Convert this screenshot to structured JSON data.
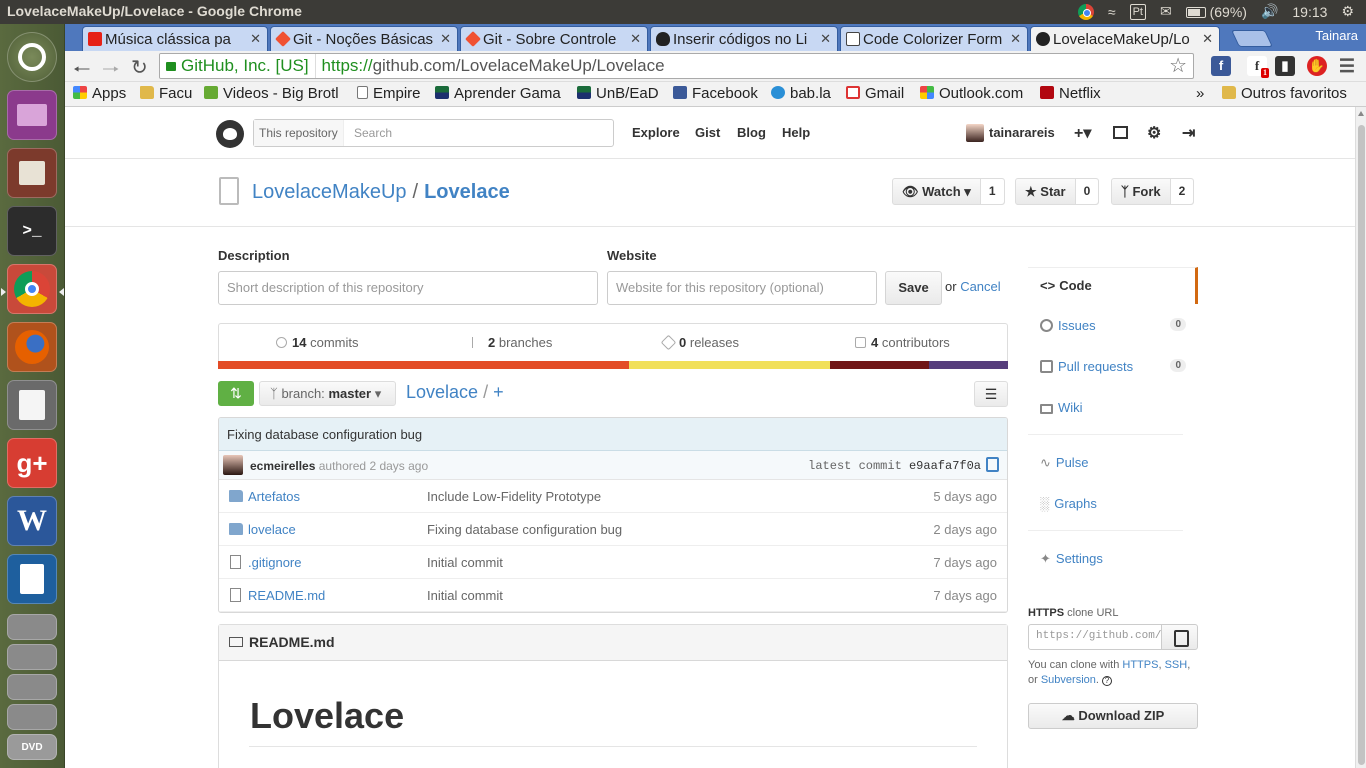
{
  "os": {
    "window_title": "LovelaceMakeUp/Lovelace - Google Chrome",
    "keyboard": "Pt",
    "battery": "(69%)",
    "clock": "19:13",
    "user": "Tainara",
    "launcher": [
      "ubuntu-dash-icon",
      "workspace-icon",
      "files-icon",
      "terminal-icon",
      "chrome-icon",
      "firefox-icon",
      "text-editor-icon",
      "google-plus-icon",
      "word-icon",
      "writer-icon",
      "drive-icon",
      "drive-icon",
      "drive-icon",
      "drive-icon",
      "dvd-icon"
    ]
  },
  "browser": {
    "tabs": [
      {
        "label": "Música clássica pa",
        "icon": "youtube-icon",
        "color": "#e62117"
      },
      {
        "label": "Git - Noções Básicas",
        "icon": "git-icon",
        "color": "#f05133"
      },
      {
        "label": "Git - Sobre Controle",
        "icon": "git-icon",
        "color": "#f05133"
      },
      {
        "label": "Inserir códigos no Li",
        "icon": "tux-icon",
        "color": "#222222"
      },
      {
        "label": "Code Colorizer Form",
        "icon": "page-icon",
        "color": "#ffffff"
      },
      {
        "label": "LovelaceMakeUp/Lo",
        "icon": "github-icon",
        "color": "#222222"
      }
    ],
    "ev_label": "GitHub, Inc. [US]",
    "url_scheme": "https://",
    "url_rest": "github.com/LovelaceMakeUp/Lovelace",
    "bookmarks": [
      {
        "label": "Apps",
        "icon": "apps-grid-icon"
      },
      {
        "label": "Facu",
        "icon": "folder-icon"
      },
      {
        "label": "Videos - Big Brotl",
        "icon": "video-icon"
      },
      {
        "label": "Empire",
        "icon": "page-icon"
      },
      {
        "label": "Aprender Gama",
        "icon": "flag-icon"
      },
      {
        "label": "UnB/EaD",
        "icon": "flag-icon"
      },
      {
        "label": "Facebook",
        "icon": "facebook-icon"
      },
      {
        "label": "bab.la",
        "icon": "bubble-icon"
      },
      {
        "label": "Gmail",
        "icon": "gmail-icon"
      },
      {
        "label": "Outlook.com",
        "icon": "windows-icon"
      },
      {
        "label": "Netflix",
        "icon": "netflix-icon"
      }
    ],
    "overflow": "»",
    "other_bookmarks": "Outros favoritos"
  },
  "github": {
    "search_scope": "This repository",
    "search_placeholder": "Search",
    "nav": [
      "Explore",
      "Gist",
      "Blog",
      "Help"
    ],
    "username": "tainarareis",
    "repo_owner": "LovelaceMakeUp",
    "repo_sep": "/",
    "repo_name": "Lovelace",
    "watch": {
      "label": "Watch",
      "count": "1"
    },
    "star": {
      "label": "Star",
      "count": "0"
    },
    "fork": {
      "label": "Fork",
      "count": "2"
    },
    "description_label": "Description",
    "description_placeholder": "Short description of this repository",
    "website_label": "Website",
    "website_placeholder": "Website for this repository (optional)",
    "save": "Save",
    "or": "or",
    "cancel": "Cancel",
    "summary": [
      {
        "num": "14",
        "label": "commits"
      },
      {
        "num": "2",
        "label": "branches"
      },
      {
        "num": "0",
        "label": "releases"
      },
      {
        "num": "4",
        "label": "contributors"
      }
    ],
    "languages": [
      {
        "share": 0.52,
        "color": "#e34c26"
      },
      {
        "share": 0.255,
        "color": "#f1e05a"
      },
      {
        "share": 0.125,
        "color": "#701516"
      },
      {
        "share": 0.1,
        "color": "#563d7c"
      }
    ],
    "branch_prefix": "branch:",
    "branch": "master",
    "breadcrumb_repo": "Lovelace",
    "breadcrumb_sep": "/",
    "breadcrumb_add": "+",
    "commit": {
      "title": "Fixing database configuration bug",
      "author": "ecmeirelles",
      "authored": "authored 2 days ago",
      "latest_label": "latest commit",
      "sha": "e9aafa7f0a"
    },
    "files": [
      {
        "type": "dir",
        "name": "Artefatos",
        "message": "Include Low-Fidelity Prototype",
        "age": "5 days ago"
      },
      {
        "type": "dir",
        "name": "lovelace",
        "message": "Fixing database configuration bug",
        "age": "2 days ago"
      },
      {
        "type": "file",
        "name": ".gitignore",
        "message": "Initial commit",
        "age": "7 days ago"
      },
      {
        "type": "file",
        "name": "README.md",
        "message": "Initial commit",
        "age": "7 days ago"
      }
    ],
    "readme_file": "README.md",
    "readme_heading": "Lovelace",
    "sidebar": [
      {
        "label": "Code",
        "icon": "code-icon",
        "selected": true
      },
      {
        "label": "Issues",
        "icon": "issue-icon",
        "badge": "0"
      },
      {
        "label": "Pull requests",
        "icon": "pull-request-icon",
        "badge": "0"
      },
      {
        "label": "Wiki",
        "icon": "book-icon"
      },
      {
        "label": "Pulse",
        "icon": "pulse-icon"
      },
      {
        "label": "Graphs",
        "icon": "graph-icon"
      },
      {
        "label": "Settings",
        "icon": "tools-icon"
      }
    ],
    "clone_proto": "HTTPS",
    "clone_label": "clone URL",
    "clone_value": "https://github.com/LovelaceMakeUp/Lovelace.git",
    "clone_help_1": "You can clone with",
    "clone_https": "HTTPS",
    "clone_ssh": "SSH",
    "clone_or": "or",
    "clone_subversion": "Subversion",
    "download_zip": "Download ZIP"
  }
}
